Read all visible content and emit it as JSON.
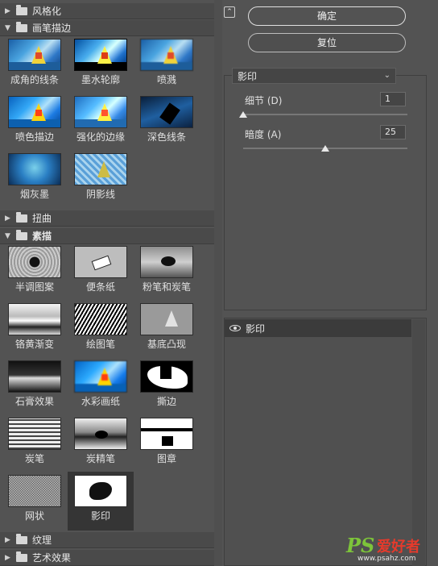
{
  "categories": {
    "stylize": "风格化",
    "brush_strokes": "画笔描边",
    "distort": "扭曲",
    "sketch": "素描",
    "texture": "纹理",
    "artistic": "艺术效果"
  },
  "brush_items": [
    "成角的线条",
    "墨水轮廓",
    "喷溅",
    "喷色描边",
    "强化的边缘",
    "深色线条",
    "烟灰墨",
    "阴影线"
  ],
  "sketch_items": [
    "半调图案",
    "便条纸",
    "粉笔和炭笔",
    "铬黄渐变",
    "绘图笔",
    "基底凸现",
    "石膏效果",
    "水彩画纸",
    "撕边",
    "炭笔",
    "炭精笔",
    "图章",
    "网状",
    "影印"
  ],
  "buttons": {
    "ok": "确定",
    "reset": "复位",
    "collapse": "⌃"
  },
  "filter_select": {
    "value": "影印"
  },
  "params": {
    "detail": {
      "label": "细节 (D)",
      "value": "1",
      "fraction": 0.0
    },
    "darkness": {
      "label": "暗度 (A)",
      "value": "25",
      "fraction": 0.5
    }
  },
  "layer": {
    "name": "影印"
  },
  "watermark": {
    "ps": "PS",
    "cn": "爱好者",
    "url": "www.psahz.com"
  }
}
